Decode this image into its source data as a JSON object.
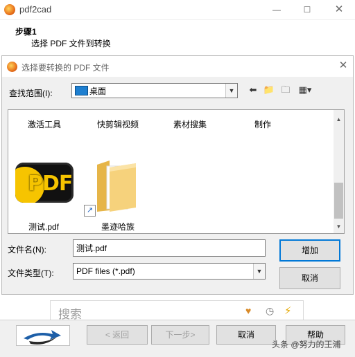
{
  "app": {
    "title": "pdf2cad"
  },
  "step": {
    "title": "步骤1",
    "description": "选择 PDF 文件到转换"
  },
  "dialog": {
    "title": "选择要转换的 PDF 文件",
    "look_in_label": "查找范围(I):",
    "look_in_value": "桌面",
    "top_row_items": [
      "激活工具",
      "快剪辑视频",
      "素材搜集",
      "制作"
    ],
    "files": [
      {
        "name": "测试.pdf",
        "icon": "pdf-icon"
      },
      {
        "name": "墨迹哈族",
        "icon": "folder-shortcut-icon"
      }
    ],
    "filename_label": "文件名(N):",
    "filename_value": "测试.pdf",
    "filetype_label": "文件类型(T):",
    "filetype_value": "PDF files (*.pdf)",
    "add_button": "增加",
    "cancel_button": "取消"
  },
  "search": {
    "placeholder": "搜索"
  },
  "nav": {
    "back": "< 返回",
    "next": "下一步>",
    "cancel": "取消",
    "help": "帮助"
  },
  "watermark": "头条 @努力的王浦",
  "colors": {
    "accent": "#0078d7",
    "desktop_icon": "#1e7fd0",
    "pdf_yellow": "#f6c400"
  }
}
